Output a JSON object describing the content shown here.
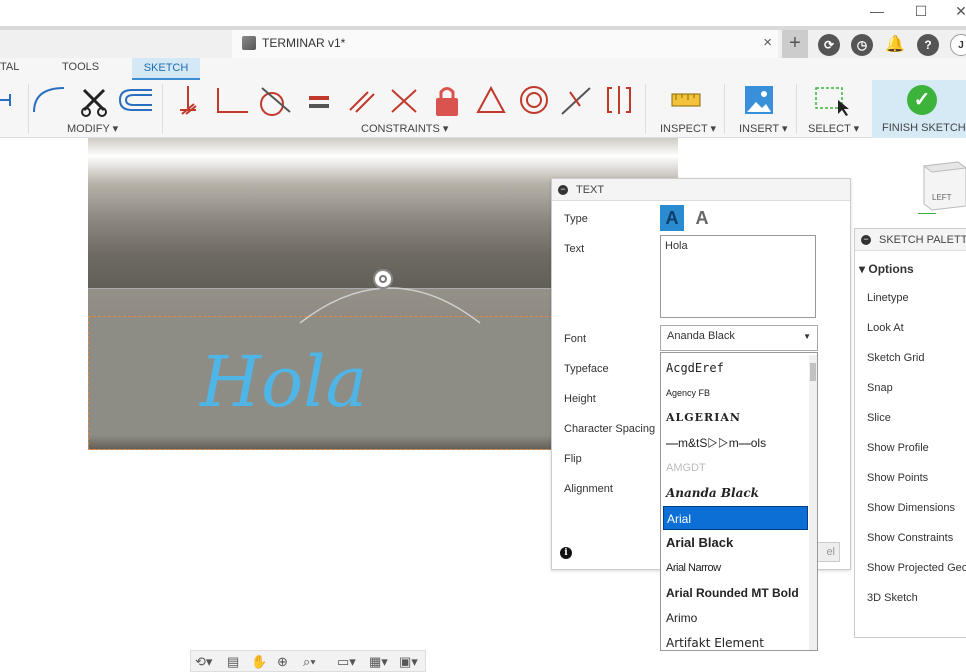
{
  "window": {
    "doc_title": "TERMINAR v1*",
    "close_tab": "×",
    "controls": [
      "—",
      "☐",
      "✕"
    ],
    "add_tab": "+",
    "account_initial": "J"
  },
  "ribbon": {
    "tabs": [
      "TAL",
      "TOOLS",
      "SKETCH"
    ],
    "groups": {
      "modify": "MODIFY ▾",
      "constraints": "CONSTRAINTS ▾",
      "inspect": "INSPECT ▾",
      "insert": "INSERT ▾",
      "select": "SELECT ▾",
      "finish": "FINISH SKETCH ▾"
    }
  },
  "viewport": {
    "sketch_text": "Hola",
    "viewcube_label": "LEFT"
  },
  "text_dialog": {
    "title": "TEXT",
    "labels": {
      "type": "Type",
      "text": "Text",
      "font": "Font",
      "typeface": "Typeface",
      "height": "Height",
      "spacing": "Character Spacing",
      "flip": "Flip",
      "alignment": "Alignment"
    },
    "text_value": "Hola",
    "font_value": "Ananda Black",
    "cancel_partial": "el",
    "info": "i"
  },
  "font_list": {
    "items": [
      "AcgdEref",
      "Agency FB",
      "ALGERIAN",
      "⎯⎯m&tS▷▷m⎯⎯ols",
      "AMGDT",
      "Ananda Black",
      "Arial",
      "Arial Black",
      "Arial Narrow",
      "Arial Rounded MT Bold",
      "Arimo",
      "Artifakt Element"
    ],
    "selected": "Arial"
  },
  "sketch_palette": {
    "title": "SKETCH PALETTE",
    "section": "Options",
    "items": [
      "Linetype",
      "Look At",
      "Sketch Grid",
      "Snap",
      "Slice",
      "Show Profile",
      "Show Points",
      "Show Dimensions",
      "Show Constraints",
      "Show Projected Geo",
      "3D Sketch"
    ]
  },
  "colors": {
    "accent": "#2b8bd1",
    "selection": "#0b6fd6",
    "finish_green": "#3cb43c",
    "sketch_text": "#4fb4e6",
    "constraint_red": "#c0392b"
  }
}
